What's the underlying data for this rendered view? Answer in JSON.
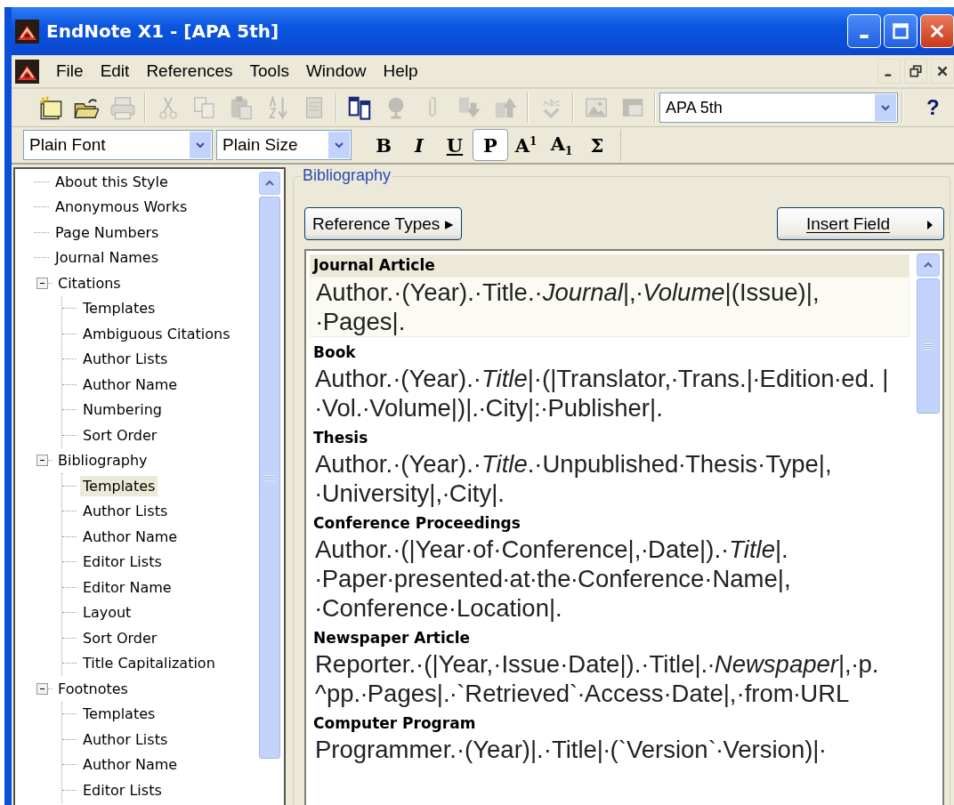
{
  "window": {
    "title": "EndNote X1 - [APA 5th]"
  },
  "menu": [
    {
      "label": "File"
    },
    {
      "label": "Edit"
    },
    {
      "label": "References"
    },
    {
      "label": "Tools"
    },
    {
      "label": "Window"
    },
    {
      "label": "Help"
    }
  ],
  "toolbar": {
    "tools": [
      {
        "kind": "new",
        "disabled": false
      },
      {
        "kind": "open",
        "disabled": false
      },
      {
        "kind": "print",
        "disabled": true
      },
      {
        "kind": "sep"
      },
      {
        "kind": "cut",
        "disabled": true
      },
      {
        "kind": "copy",
        "disabled": true
      },
      {
        "kind": "paste",
        "disabled": true
      },
      {
        "kind": "sort",
        "disabled": true
      },
      {
        "kind": "page",
        "disabled": true
      },
      {
        "kind": "sep"
      },
      {
        "kind": "windows",
        "disabled": false
      },
      {
        "kind": "globe",
        "disabled": true
      },
      {
        "kind": "clip",
        "disabled": true
      },
      {
        "kind": "down",
        "disabled": true
      },
      {
        "kind": "up",
        "disabled": true
      },
      {
        "kind": "sep"
      },
      {
        "kind": "spell",
        "disabled": true
      },
      {
        "kind": "sep"
      },
      {
        "kind": "image",
        "disabled": true
      },
      {
        "kind": "frame",
        "disabled": true
      }
    ],
    "style_select": "APA 5th",
    "help": "?"
  },
  "format_bar": {
    "font": "Plain Font",
    "size": "Plain Size",
    "buttons": [
      {
        "label": "B",
        "kind": "bold",
        "selected": false
      },
      {
        "label": "I",
        "kind": "italic",
        "selected": false
      },
      {
        "label": "U",
        "kind": "underline",
        "selected": false
      },
      {
        "label": "P",
        "kind": "plain",
        "selected": true
      },
      {
        "label": "A$^{1}$",
        "kind": "super",
        "selected": false
      },
      {
        "label": "A$_{1}$",
        "kind": "sub",
        "selected": false
      },
      {
        "label": "Σ",
        "kind": "symbol",
        "selected": false
      }
    ]
  },
  "tree": [
    {
      "label": "About this Style",
      "selected": false
    },
    {
      "label": "Anonymous Works",
      "selected": false
    },
    {
      "label": "Page Numbers",
      "selected": false
    },
    {
      "label": "Journal Names",
      "selected": false
    },
    {
      "label": "Citations",
      "selected": false,
      "expanded": true,
      "children": [
        {
          "label": "Templates",
          "selected": false
        },
        {
          "label": "Ambiguous Citations",
          "selected": false
        },
        {
          "label": "Author Lists",
          "selected": false
        },
        {
          "label": "Author Name",
          "selected": false
        },
        {
          "label": "Numbering",
          "selected": false
        },
        {
          "label": "Sort Order",
          "selected": false
        }
      ]
    },
    {
      "label": "Bibliography",
      "selected": false,
      "expanded": true,
      "children": [
        {
          "label": "Templates",
          "selected": true
        },
        {
          "label": "Author Lists",
          "selected": false
        },
        {
          "label": "Author Name",
          "selected": false
        },
        {
          "label": "Editor Lists",
          "selected": false
        },
        {
          "label": "Editor Name",
          "selected": false
        },
        {
          "label": "Layout",
          "selected": false
        },
        {
          "label": "Sort Order",
          "selected": false
        },
        {
          "label": "Title Capitalization",
          "selected": false
        }
      ]
    },
    {
      "label": "Footnotes",
      "selected": false,
      "expanded": true,
      "children": [
        {
          "label": "Templates",
          "selected": false
        },
        {
          "label": "Author Lists",
          "selected": false
        },
        {
          "label": "Author Name",
          "selected": false
        },
        {
          "label": "Editor Lists",
          "selected": false
        }
      ]
    }
  ],
  "panel": {
    "title": "Bibliography",
    "reference_types_button": "Reference Types ▸",
    "insert_field_button": "Insert Field",
    "templates": [
      {
        "type": "Journal Article",
        "template": "Author.·(Year).·Title.·*Journal*|,∙*Volume*|(Issue)|, ∙Pages|.",
        "selected": true
      },
      {
        "type": "Book",
        "template": "Author.·(Year).·*Title*|·(|Translator,∙Trans.|∙Edition∙ed. |∙Vol.∙Volume|)|.∙City|:∙Publisher|.",
        "selected": false
      },
      {
        "type": "Thesis",
        "template": "Author.·(Year).·*Title*.·Unpublished∙Thesis·Type|, ∙University|,∙City|.",
        "selected": false
      },
      {
        "type": "Conference Proceedings",
        "template": "Author.·(|Year·of·Conference|,∙Date|).·*Title*|. ∙Paper∙presented∙at∙the∙Conference·Name|, ∙Conference·Location|.",
        "selected": false
      },
      {
        "type": "Newspaper Article",
        "template": "Reporter.·(|Year,·Issue·Date|).·Title|.∙*Newspaper*|,∙p. ^pp.∙Pages|.∙`Retrieved`∙Access·Date|,·from∙URL",
        "selected": false
      },
      {
        "type": "Computer Program",
        "template": "Programmer.·(Year)|.·Title|∙(`Version`∙Version)|∙",
        "selected": false
      }
    ]
  }
}
